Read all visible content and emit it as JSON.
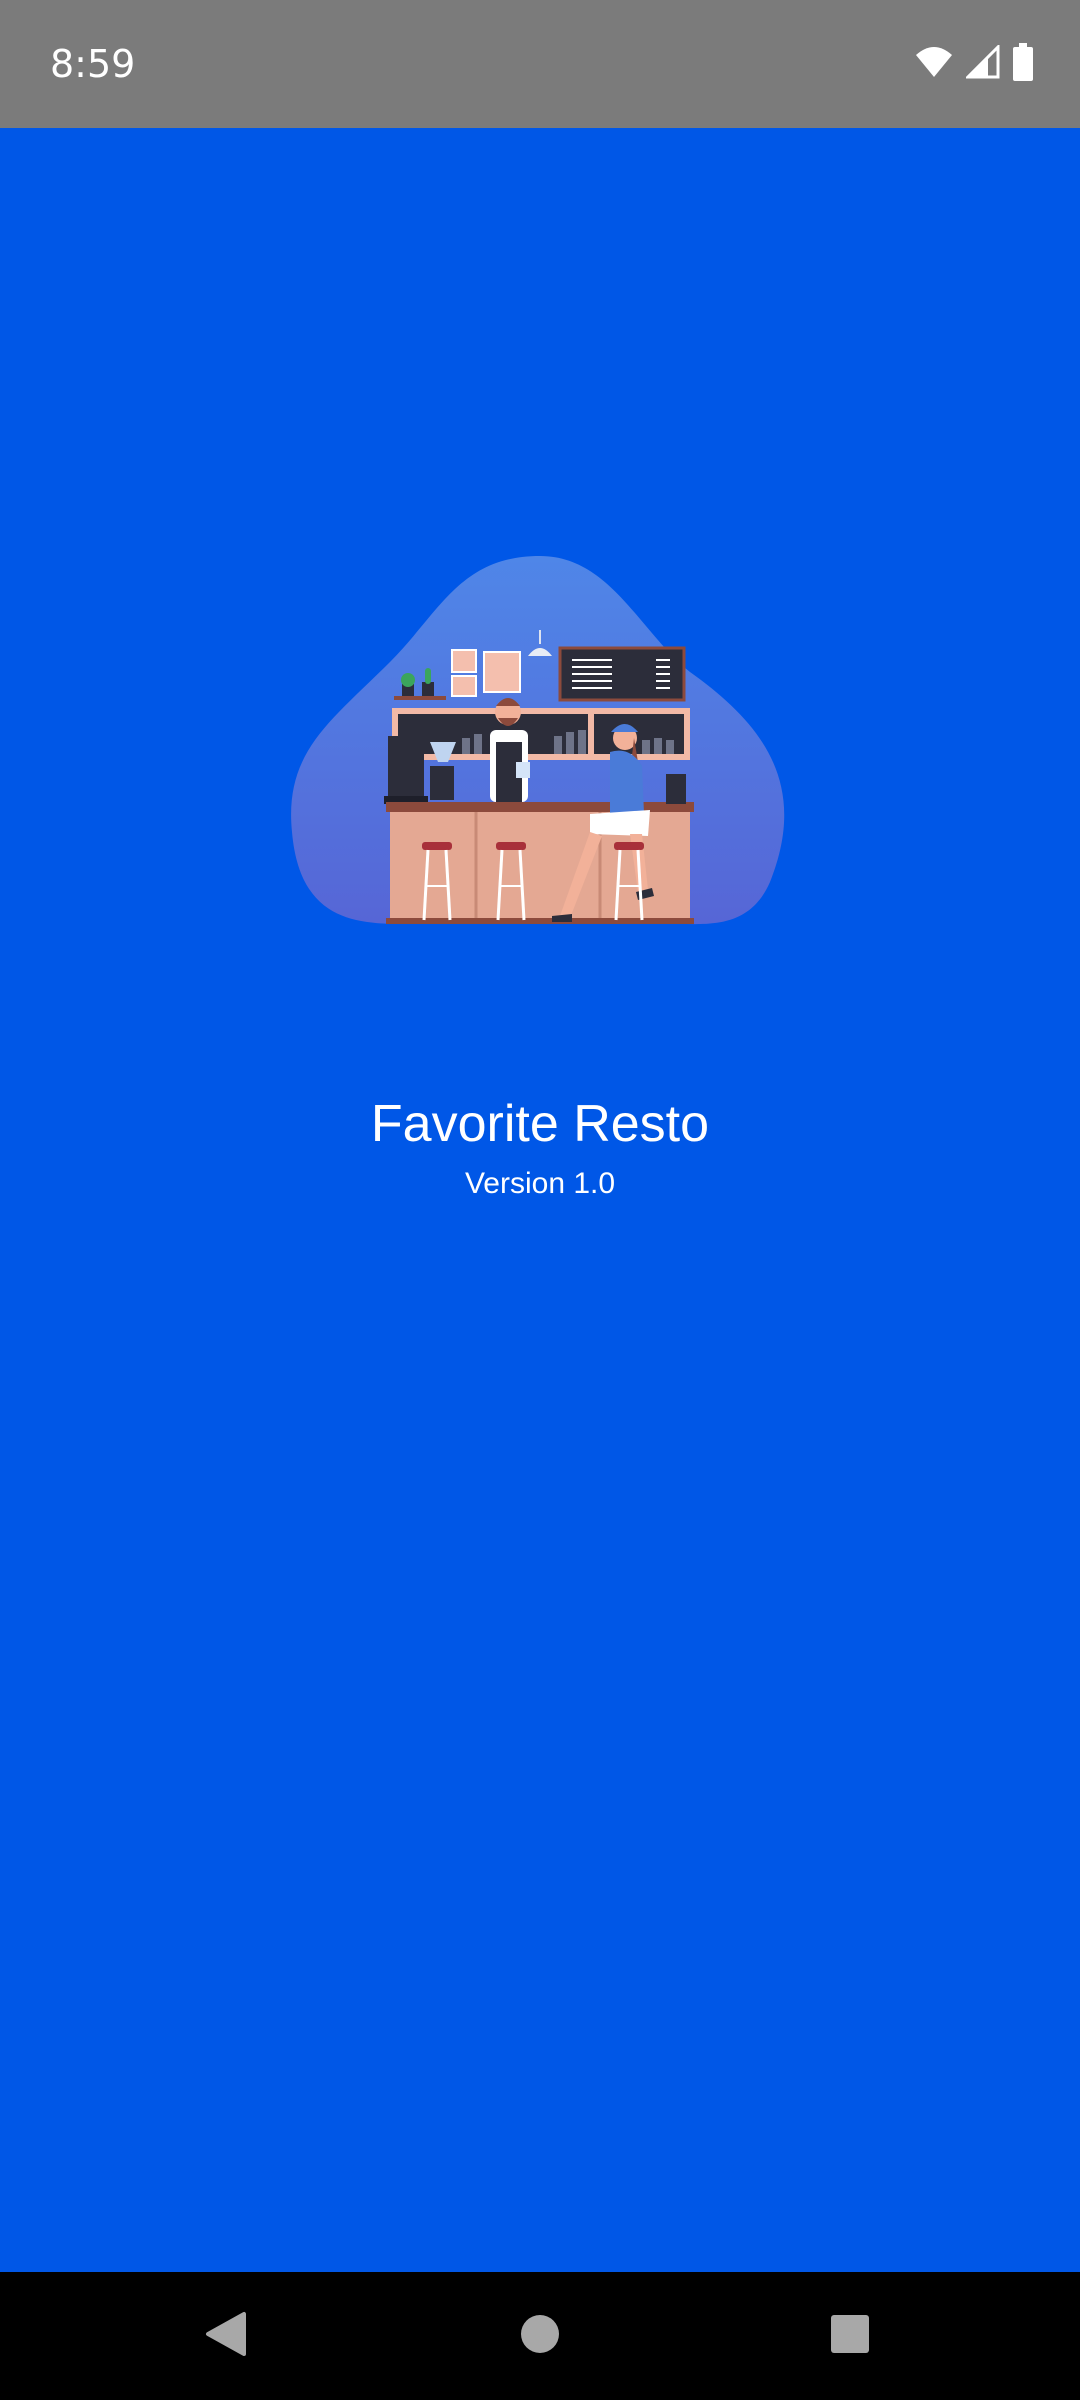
{
  "status_bar": {
    "time": "8:59",
    "icons": [
      "wifi-icon",
      "cell-signal-icon",
      "battery-icon"
    ]
  },
  "splash": {
    "title": "Favorite Resto",
    "version": "Version 1.0",
    "illustration": "coffee-shop-illustration"
  },
  "nav_bar": {
    "buttons": [
      "back-icon",
      "home-icon",
      "recents-icon"
    ]
  },
  "colors": {
    "background": "#0057E7",
    "status_bar": "#7B7B7B",
    "nav_bar": "#000000",
    "text": "#FFFFFF"
  }
}
